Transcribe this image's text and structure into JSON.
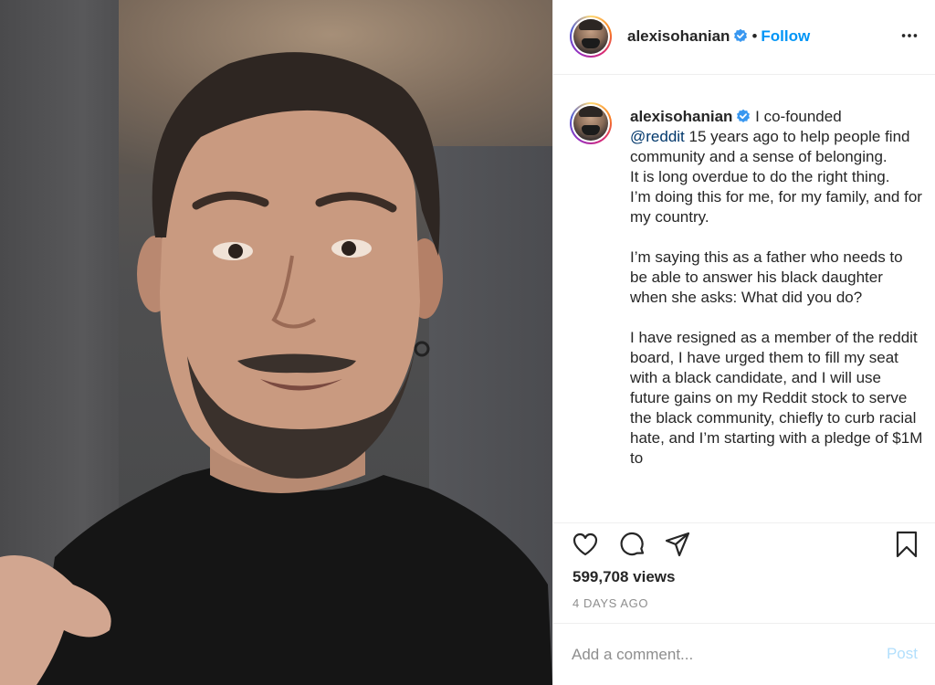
{
  "post": {
    "username": "alexisohanian",
    "verified": true,
    "header_separator": "•",
    "follow_label": "Follow",
    "more_icon": "more-options-icon"
  },
  "caption": {
    "username": "alexisohanian",
    "first_line_rest": " I co-founded",
    "mention": "@reddit",
    "after_mention": " 15 years ago to help people find community and a sense of belonging.",
    "line2": "It is long overdue to do the right thing.",
    "line3": "I’m doing this for me, for my family, and for my country.",
    "para2": "I’m saying this as a father who needs to be able to answer his black daughter when she asks: What did you do?",
    "para3": "I have resigned as a member of the reddit board, I have urged them to fill my seat with a black candidate, and I will use future gains on my Reddit stock to serve the black community, chiefly to curb racial hate, and I’m starting with a pledge of $1M to"
  },
  "actions": {
    "icons": [
      "heart-icon",
      "comment-icon",
      "share-icon",
      "bookmark-icon"
    ],
    "views": "599,708 views",
    "posted_ago": "4 DAYS AGO"
  },
  "comment": {
    "placeholder": "Add a comment...",
    "post_label": "Post"
  },
  "colors": {
    "link": "#0095f6",
    "mention": "#00376b",
    "muted": "#8e8e8e",
    "post_disabled": "#b2dffc"
  }
}
